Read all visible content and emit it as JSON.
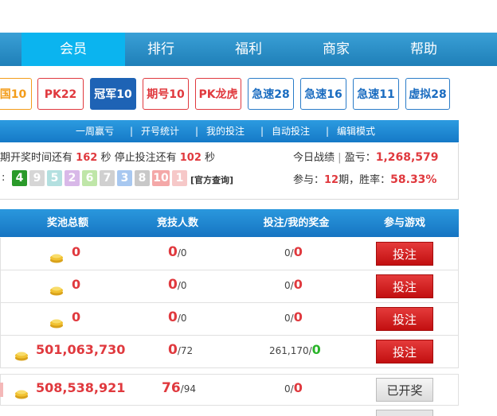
{
  "nav": {
    "tabs": [
      {
        "label": "会员",
        "active": true
      },
      {
        "label": "排行"
      },
      {
        "label": "福利"
      },
      {
        "label": "商家"
      },
      {
        "label": "帮助"
      }
    ]
  },
  "games": [
    {
      "label": "国10",
      "color": "#f39c1a"
    },
    {
      "label": "PK22",
      "color": "#e0393e"
    },
    {
      "label": "冠军10",
      "selected": true,
      "color": "#1e63b5"
    },
    {
      "label": "期号10",
      "color": "#e0393e"
    },
    {
      "label": "PK龙虎",
      "color": "#e0393e"
    },
    {
      "label": "急速28",
      "color": "#1a6cc0"
    },
    {
      "label": "急速16",
      "color": "#1a6cc0"
    },
    {
      "label": "急速11",
      "color": "#1a6cc0"
    },
    {
      "label": "虚拟28",
      "color": "#1a6cc0"
    }
  ],
  "submenu": [
    "一周赢亏",
    "开号统计",
    "我的投注",
    "自动投注",
    "编辑模式"
  ],
  "submenu_sep": "|",
  "info": {
    "countdown_prefix": "期开奖时间还有",
    "countdown_seconds": "162",
    "sec_unit": "秒",
    "stop_prefix": "停止投注还有",
    "stop_seconds": "102",
    "today_label": "今日战绩",
    "sep": "|",
    "profit_label": "盈亏：",
    "profit_value": "1,268,579",
    "participate_label": "参与：",
    "participate_value": "12",
    "period_unit": "期",
    "winrate_label": "，胜率：",
    "winrate_value": "58.33%",
    "result_prefix": ":",
    "balls": [
      {
        "n": "4",
        "color": "#2a9a2a"
      },
      {
        "n": "9",
        "color": "#d6d6d6"
      },
      {
        "n": "5",
        "color": "#b3e0e0"
      },
      {
        "n": "2",
        "color": "#d8b8e8"
      },
      {
        "n": "6",
        "color": "#bfe6a8"
      },
      {
        "n": "7",
        "color": "#d0d0d0"
      },
      {
        "n": "3",
        "color": "#a8c8f0"
      },
      {
        "n": "8",
        "color": "#c8c8c8"
      },
      {
        "n": "10",
        "color": "#f4a8a8"
      },
      {
        "n": "1",
        "color": "#f6c8c8"
      }
    ],
    "official_query": "[官方查询]"
  },
  "table": {
    "headers": [
      "奖池总额",
      "竞技人数",
      "投注/我的奖金",
      "参与游戏"
    ],
    "rows": [
      {
        "pool": "0",
        "players": "0",
        "players_total": "/0",
        "bet": "0/",
        "bonus": "0",
        "action": "投注",
        "action_type": "bet"
      },
      {
        "pool": "0",
        "players": "0",
        "players_total": "/0",
        "bet": "0/",
        "bonus": "0",
        "action": "投注",
        "action_type": "bet"
      },
      {
        "pool": "0",
        "players": "0",
        "players_total": "/0",
        "bet": "0/",
        "bonus": "0",
        "action": "投注",
        "action_type": "bet"
      },
      {
        "pool": "501,063,730",
        "players": "0",
        "players_total": "/72",
        "bet": "261,170/",
        "bonus": "0",
        "bonus_green": true,
        "action": "投注",
        "action_type": "bet"
      },
      {
        "pool": "508,538,921",
        "players": "76",
        "players_total": "/94",
        "bet": "0/",
        "bonus": "0",
        "action": "已开奖",
        "action_type": "done"
      }
    ]
  },
  "colors": {
    "accent": "#1f7fb8",
    "active_tab": "#0bb4ef",
    "red": "#e0393e",
    "bet_button": "#d42020"
  }
}
